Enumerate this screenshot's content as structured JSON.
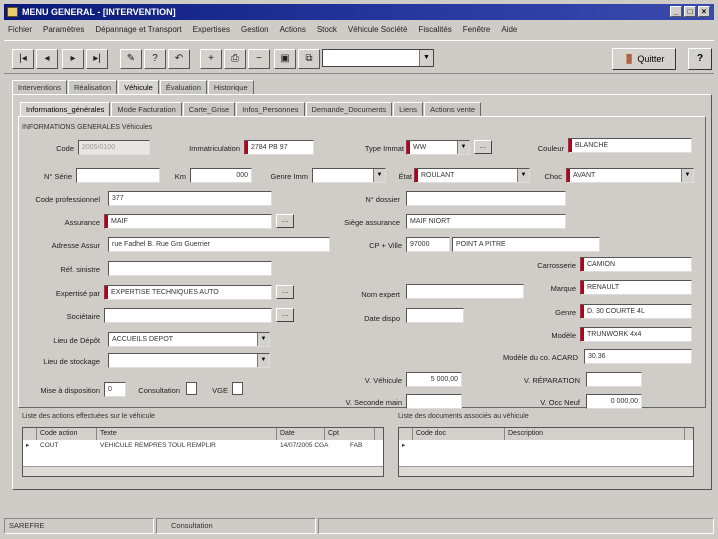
{
  "window": {
    "title": "MENU GENERAL - [INTERVENTION]"
  },
  "menu": [
    "Fichier",
    "Paramètres",
    "Dépannage et Transport",
    "Expertises",
    "Gestion",
    "Actions",
    "Stock",
    "Véhicule Société",
    "Fiscalités",
    "Fenêtre",
    "Aide"
  ],
  "toolbar": {
    "quit_label": "Quitter",
    "help_label": "?",
    "combo_value": ""
  },
  "tabs_top": [
    "Interventions",
    "Réalisation",
    "Véhicule",
    "Évaluation",
    "Historique"
  ],
  "tabs_inner": [
    "Informations_générales",
    "Mode Facturation",
    "Carte_Grise",
    "Infos_Personnes",
    "Demande_Documents",
    "Liens",
    "Actions vente"
  ],
  "section_title": "INFORMATIONS GENERALES Véhicules",
  "fields": {
    "code_label": "Code",
    "code_value": "2005/0100",
    "immat_label": "Immatriculation",
    "immat_value": "2784 PB 97",
    "type_label": "Type Immat",
    "type_value": "WW",
    "couleur_label": "Couleur",
    "couleur_value": "BLANCHE",
    "serie_label": "N° Série",
    "serie_value": "",
    "km_label": "Km",
    "km_value": "000",
    "genre_label": "Genre Imm",
    "genre_value": "",
    "etat_label": "État",
    "etat_value": "ROULANT",
    "choc_label": "Choc",
    "choc_value": "AVANT",
    "code_prof_label": "Code professionnel",
    "code_prof_value": "377",
    "dossier_label": "N° dossier",
    "dossier_value": "",
    "assurance_label": "Assurance",
    "assurance_value": "MAIF",
    "siege_label": "Siège assurance",
    "siege_value": "MAIF NIORT",
    "adresse_label": "Adresse Assur",
    "adresse_value": "rue Fadhel B. Rue Gro Guerrier",
    "cp_label": "CP + Ville",
    "cp_value": "97000",
    "ville_value": "POINT A PITRE",
    "ref_label": "Réf. sinistre",
    "ref_value": "",
    "carrosserie_label": "Carrosserie",
    "carrosserie_value": "CAMION",
    "expertise_label": "Expertisé par",
    "expertise_value": "EXPERTISE TECHNIQUES AUTO",
    "nom_expert_label": "Nom expert",
    "nom_expert_value": "",
    "marque_label": "Marque",
    "marque_value": "RENAULT",
    "sociétaire_label": "Sociétaire",
    "sociétaire_value": "",
    "date_dispo_label": "Date dispo",
    "date_dispo_value": "",
    "genre2_label": "Genre",
    "genre2_value": "D. 30 COURTE 4L",
    "lieu_depot_label": "Lieu de Dépôt",
    "lieu_depot_value": "ACCUEILS DEPOT",
    "modele_label": "Modèle",
    "modele_value": "TRUNWORK 4x4",
    "lieu_stock_label": "Lieu de stockage",
    "lieu_stock_value": "",
    "modele_act_label": "Modèle du co. ACARD",
    "modele_act_value": "30.36",
    "mise_label": "Mise à disposition",
    "mise_value": "0",
    "ve_label": "V. Véhicule",
    "ve_value": "5 000,00",
    "rep_label": "V. RÉPARATION",
    "rep_value": "",
    "cons_label": "Consultation",
    "cons_value": "",
    "vge_label": "VGE",
    "vge_value": "",
    "vr_label": "V. Seconde main",
    "vr_value": "",
    "vep_label": "V. Occ Neuf",
    "vep_value": "0 000,00"
  },
  "grid_left": {
    "title": "Liste des actions effectuées sur le véhicule",
    "headers": [
      "Code action",
      "Texte",
      "Date",
      "Cpt"
    ],
    "row": [
      "COUT",
      "VEHICULE REMPRES TOUL REMPLIR",
      "14/07/2005 CGA",
      "FAB"
    ]
  },
  "grid_right": {
    "title": "Liste des documents associés au véhicule",
    "headers": [
      "Code doc",
      "Description"
    ],
    "row": [
      "",
      ""
    ]
  },
  "status": {
    "left": "SAREFRE",
    "middle": "Consultation"
  }
}
